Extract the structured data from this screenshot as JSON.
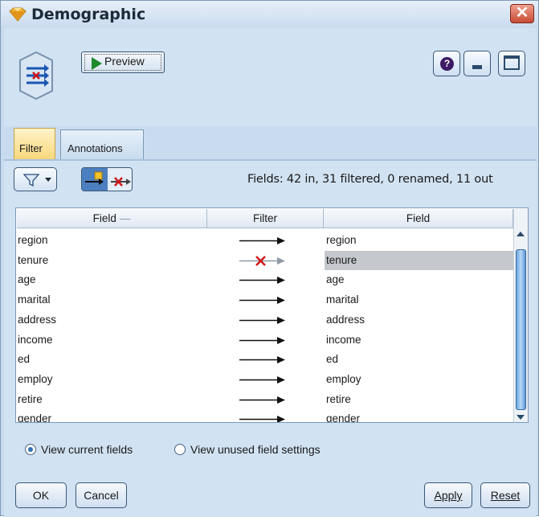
{
  "window": {
    "title": "Demographic",
    "close_label": "✕"
  },
  "toolbar": {
    "preview_label": "Preview"
  },
  "tabs": [
    {
      "label": "Filter"
    },
    {
      "label": "Annotations"
    }
  ],
  "status": "Fields: 42 in, 31 filtered, 0 renamed, 11 out",
  "table": {
    "columns": [
      "Field",
      "Filter",
      "Field"
    ],
    "rows": [
      {
        "in": "region",
        "filtered": false,
        "out": "region"
      },
      {
        "in": "tenure",
        "filtered": true,
        "out": "tenure"
      },
      {
        "in": "age",
        "filtered": false,
        "out": "age"
      },
      {
        "in": "marital",
        "filtered": false,
        "out": "marital"
      },
      {
        "in": "address",
        "filtered": false,
        "out": "address"
      },
      {
        "in": "income",
        "filtered": false,
        "out": "income"
      },
      {
        "in": "ed",
        "filtered": false,
        "out": "ed"
      },
      {
        "in": "employ",
        "filtered": false,
        "out": "employ"
      },
      {
        "in": "retire",
        "filtered": false,
        "out": "retire"
      },
      {
        "in": "gender",
        "filtered": false,
        "out": "gender"
      }
    ],
    "selected_row": 1
  },
  "view_options": [
    {
      "label": "View current fields",
      "checked": true
    },
    {
      "label": "View unused field settings",
      "checked": false
    }
  ],
  "buttons": {
    "ok": "OK",
    "cancel": "Cancel",
    "apply": "Apply",
    "reset": "Reset"
  },
  "colors": {
    "accent": "#c9dcef",
    "selected_row": "#c5c9cd",
    "remove_x": "#d01818"
  }
}
